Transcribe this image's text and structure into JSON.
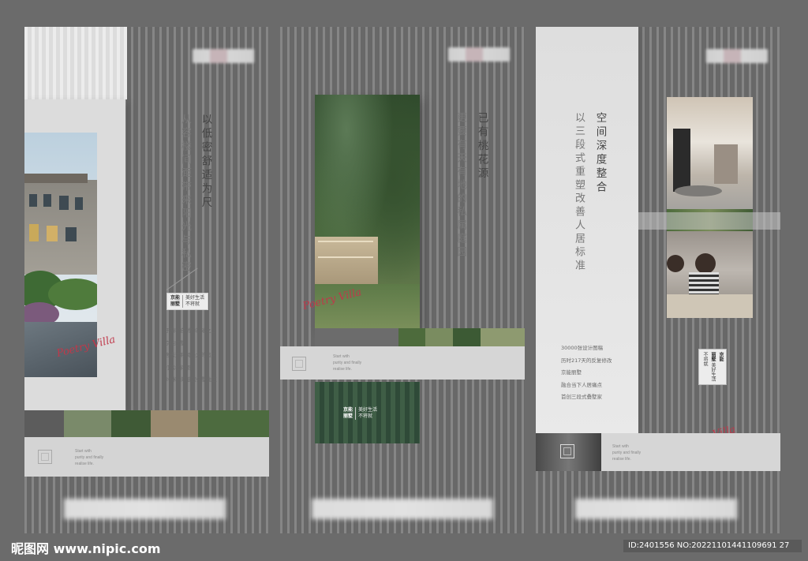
{
  "panel1": {
    "title": "以低密舒适为尺",
    "subtitle": "从容楼间距带来阳光与私密",
    "signature": "Poetry Villa",
    "logo": {
      "brand": "京能\n丽墅",
      "slogan": "美好生活\n不将就"
    },
    "lines": [
      "于臻稀自然的基础之上",
      "京能丽墅",
      "舍去对利润最大的追求",
      "打造楼间距",
      "20米+的低密叠墅住区"
    ],
    "english": [
      "Start with",
      "purity and finally",
      "realise life."
    ]
  },
  "panel2": {
    "title": "已有桃花源",
    "subtitle": "更要有天有地的私属庭园",
    "signature": "Poetry Villa",
    "english": [
      "Start with",
      "purity and finally",
      "realise life."
    ],
    "logo": {
      "brand": "京能\n丽墅",
      "slogan": "美好生活\n不将就"
    }
  },
  "panel3": {
    "title": "空间深度整合",
    "subtitle": "以三段式重塑改善人居标准",
    "signature": "Poetry Villa",
    "logo": {
      "brand": "京能\n丽墅",
      "slogan": "美好生活\n不将就"
    },
    "lines": [
      "30000张设计图稿",
      "历时217天的反复修改",
      "京能丽墅",
      "融合当下人居痛点",
      "首创三段式叠墅家"
    ],
    "english": [
      "Start with",
      "purity and finally",
      "realise life."
    ]
  },
  "watermark": {
    "site": "昵图网 www.nipic.com",
    "id": "ID:2401556 NO:20221101441109691 27"
  },
  "colors": {
    "background": "#6b6b6b",
    "panel": "#e6e6e6",
    "signature": "#c0384a"
  }
}
